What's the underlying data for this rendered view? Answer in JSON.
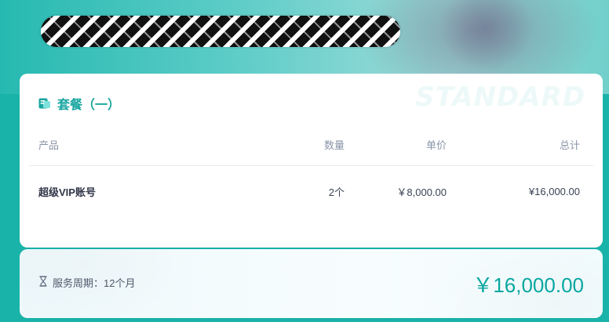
{
  "plan": {
    "title": "套餐（一）",
    "watermark": "STANDARD",
    "icon": "plan-icon"
  },
  "table": {
    "headers": {
      "product": "产品",
      "quantity": "数量",
      "unit_price": "单价",
      "total": "总计"
    },
    "rows": [
      {
        "product": "超级VIP账号",
        "quantity": "2个",
        "unit_price": "￥8,000.00",
        "total": "¥16,000.00"
      }
    ]
  },
  "summary": {
    "service_text": "服务周期：12个月",
    "total_amount": "￥16,000.00",
    "icon": "hourglass-icon"
  },
  "colors": {
    "accent": "#19a6a0",
    "background": "#19b3aa"
  }
}
